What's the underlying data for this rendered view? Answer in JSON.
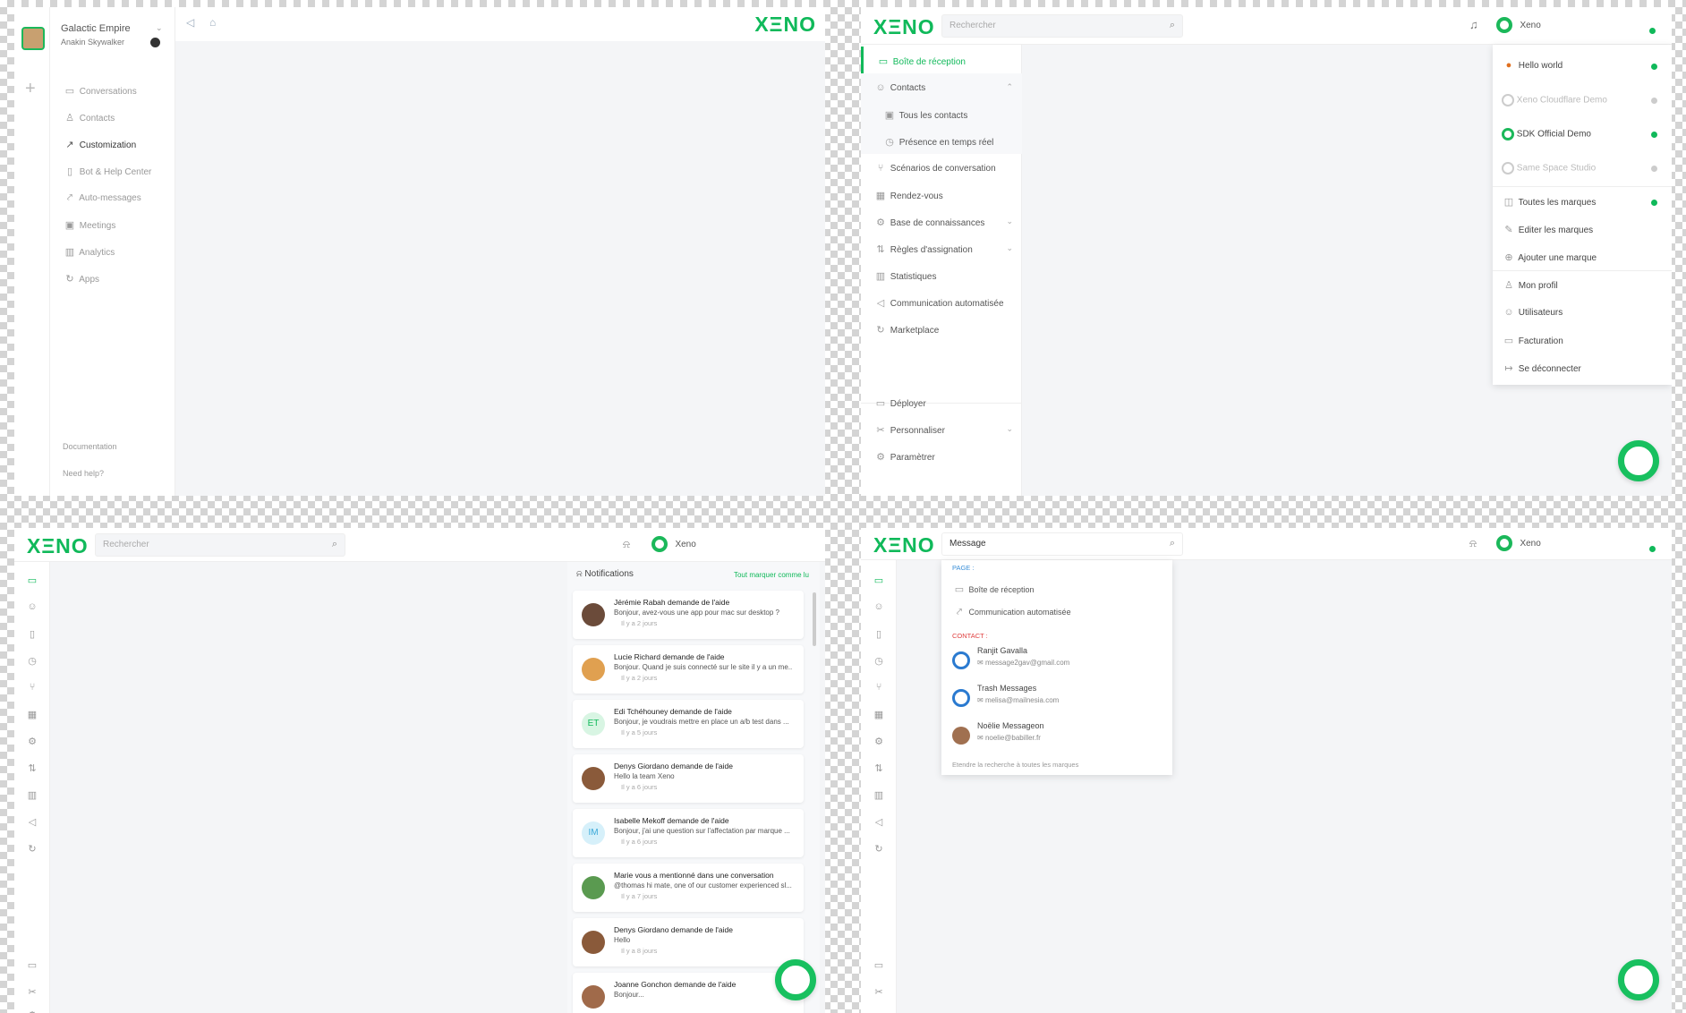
{
  "brand": {
    "logo": "XΞNO",
    "accent": "#10b95a"
  },
  "panel1": {
    "org_name": "Galactic Empire",
    "user_name": "Anakin Skywalker",
    "nav": [
      "Conversations",
      "Contacts",
      "Customization",
      "Bot & Help Center",
      "Auto-messages",
      "Meetings",
      "Analytics",
      "Apps"
    ],
    "footer": [
      "Documentation",
      "Need help?"
    ]
  },
  "panel2": {
    "search_placeholder": "Rechercher",
    "account_name": "Xeno",
    "menu": [
      {
        "label": "Boîte de réception",
        "active": true
      },
      {
        "label": "Contacts",
        "expandable": true
      },
      {
        "label": "Tous les contacts",
        "sub": true
      },
      {
        "label": "Présence en temps réel",
        "sub": true
      },
      {
        "label": "Scénarios de conversation"
      },
      {
        "label": "Rendez-vous"
      },
      {
        "label": "Base de connaissances",
        "expandable": true
      },
      {
        "label": "Règles d'assignation",
        "expandable": true
      },
      {
        "label": "Statistiques"
      },
      {
        "label": "Communication automatisée"
      },
      {
        "label": "Marketplace"
      }
    ],
    "bottom_menu": [
      {
        "label": "Déployer"
      },
      {
        "label": "Personnaliser",
        "expandable": true
      },
      {
        "label": "Paramètrer"
      }
    ],
    "brands": [
      {
        "label": "Hello world",
        "status": "active"
      },
      {
        "label": "Xeno Cloudflare Demo",
        "status": "inactive"
      },
      {
        "label": "SDK Official Demo",
        "status": "active"
      },
      {
        "label": "Same Space Studio",
        "status": "inactive"
      },
      {
        "label": "Toutes les marques",
        "status": "active"
      }
    ],
    "brand_actions": [
      "Editer les marques",
      "Ajouter une marque"
    ],
    "account_actions": [
      "Mon profil",
      "Utilisateurs",
      "Facturation",
      "Se déconnecter"
    ]
  },
  "panel3": {
    "search_placeholder": "Rechercher",
    "account_name": "Xeno",
    "notifications_title": "Notifications",
    "mark_all_read": "Tout marquer comme lu",
    "notifications": [
      {
        "title": "Jérémie Rabah demande de l'aide",
        "message": "Bonjour, avez-vous une app pour mac sur desktop ?",
        "time": "Il y a 2 jours",
        "initials": ""
      },
      {
        "title": "Lucie Richard demande de l'aide",
        "message": "Bonjour. Quand je suis connecté sur le site il y a un me...",
        "time": "Il y a 2 jours",
        "initials": ""
      },
      {
        "title": "Edi Tchéhouney demande de l'aide",
        "message": "Bonjour, je voudrais mettre en place un a/b test dans ...",
        "time": "Il y a 5 jours",
        "initials": "ET"
      },
      {
        "title": "Denys Giordano demande de l'aide",
        "message": "Hello la team Xeno",
        "time": "Il y a 6 jours",
        "initials": ""
      },
      {
        "title": "Isabelle Mekoff demande de l'aide",
        "message": "Bonjour, j'ai une question sur l'affectation par marque ...",
        "time": "Il y a 6 jours",
        "initials": "IM"
      },
      {
        "title": "Marie vous a mentionné dans une conversation",
        "message": "@thomas hi mate, one of our customer experienced sl...",
        "time": "Il y a 7 jours",
        "initials": ""
      },
      {
        "title": "Denys Giordano demande de l'aide",
        "message": "Hello",
        "time": "Il y a 8 jours",
        "initials": ""
      },
      {
        "title": "Joanne Gonchon demande de l'aide",
        "message": "Bonjour...",
        "time": "",
        "initials": ""
      }
    ]
  },
  "panel4": {
    "search_value": "Message",
    "account_name": "Xeno",
    "section_page": "PAGE :",
    "pages": [
      "Boîte de réception",
      "Communication automatisée"
    ],
    "section_contact": "CONTACT :",
    "contacts": [
      {
        "name": "Ranjit Gavalla",
        "email": "message2gav@gmail.com"
      },
      {
        "name": "Trash Messages",
        "email": "melisa@mailnesia.com"
      },
      {
        "name": "Noëlie Messageon",
        "email": "noelie@babiller.fr"
      }
    ],
    "extend_search": "Etendre la recherche à toutes les marques"
  }
}
